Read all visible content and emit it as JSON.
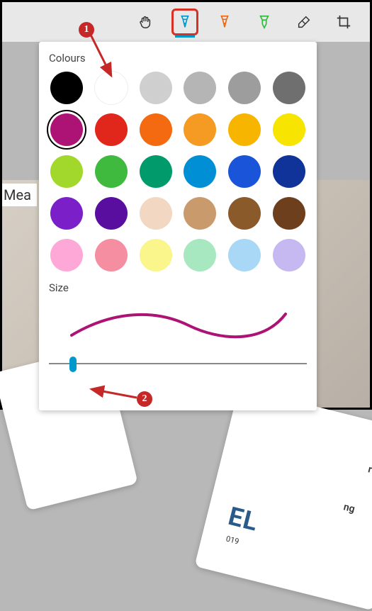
{
  "toolbar": {
    "tools": [
      {
        "name": "pan-tool",
        "icon": "hand",
        "selected": false,
        "active": false
      },
      {
        "name": "pen-tool",
        "icon": "pen",
        "selected": true,
        "active": true,
        "color": "#0099cc"
      },
      {
        "name": "pen-orange-tool",
        "icon": "pen",
        "selected": false,
        "active": false,
        "color": "#e86a17"
      },
      {
        "name": "highlighter-tool",
        "icon": "highlighter",
        "selected": false,
        "active": false,
        "color": "#2dbd3a"
      },
      {
        "name": "eraser-tool",
        "icon": "eraser",
        "selected": false,
        "active": false
      },
      {
        "name": "crop-tool",
        "icon": "crop",
        "selected": false,
        "active": false
      }
    ]
  },
  "popup": {
    "colours_label": "Colours",
    "size_label": "Size",
    "selected_colour_index": 6,
    "colours": [
      "#000000",
      "#ffffff",
      "#cfcfcf",
      "#b5b5b5",
      "#9d9d9d",
      "#6f6f6f",
      "#ad1374",
      "#e1261c",
      "#f36a10",
      "#f59a23",
      "#f7b500",
      "#f7e400",
      "#a2d82b",
      "#3fba3f",
      "#009a6b",
      "#008fd4",
      "#1a54d9",
      "#10339a",
      "#7b20c9",
      "#5a0ea0",
      "#f2d8c2",
      "#c99a6c",
      "#8b5a2b",
      "#6e3f1c",
      "#fda8d6",
      "#f58ea0",
      "#faf68c",
      "#a8e8c0",
      "#a8d8f5",
      "#c6b8f0"
    ],
    "size_value": 0.08,
    "stroke_colour": "#ad1374"
  },
  "background": {
    "peek_text": "Mea",
    "card2_line1": "r",
    "card2_line2": "ng",
    "card2_big": "EL",
    "card2_small": "019"
  },
  "annotations": {
    "badge1": "1",
    "badge2": "2"
  }
}
